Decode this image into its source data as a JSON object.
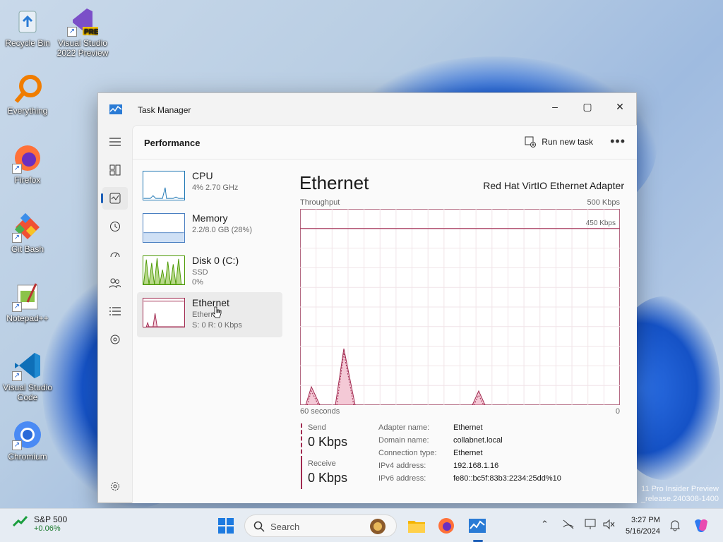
{
  "desktop": {
    "icons": [
      {
        "label": "Recycle Bin",
        "icon": "recycle-bin-icon"
      },
      {
        "label": "Visual Studio 2022 Preview",
        "icon": "visual-studio-icon",
        "badge": "PRE"
      },
      {
        "label": "Everything",
        "icon": "everything-search-icon"
      },
      {
        "label": "Firefox",
        "icon": "firefox-icon"
      },
      {
        "label": "Git Bash",
        "icon": "git-bash-icon"
      },
      {
        "label": "Notepad++",
        "icon": "notepadpp-icon"
      },
      {
        "label": "Visual Studio Code",
        "icon": "vscode-icon"
      },
      {
        "label": "Chromium",
        "icon": "chromium-icon"
      }
    ],
    "watermark_line1": "11 Pro Insider Preview",
    "watermark_line2": "_release.240308-1400"
  },
  "window": {
    "title": "Task Manager",
    "page_title": "Performance",
    "run_new_task": "Run new task",
    "more": "•••",
    "min": "–",
    "max": "▢",
    "close": "✕"
  },
  "perf_items": [
    {
      "name": "CPU",
      "sub1": "4%  2.70 GHz",
      "sub2": ""
    },
    {
      "name": "Memory",
      "sub1": "2.2/8.0 GB (28%)",
      "sub2": ""
    },
    {
      "name": "Disk 0 (C:)",
      "sub1": "SSD",
      "sub2": "0%"
    },
    {
      "name": "Ethernet",
      "sub1": "Ethern",
      "sub2": "S: 0  R: 0 Kbps"
    }
  ],
  "detail": {
    "title": "Ethernet",
    "adapter": "Red Hat VirtIO Ethernet Adapter",
    "throughput_label": "Throughput",
    "max_label": "500 Kbps",
    "line_label": "450 Kbps",
    "time_left": "60 seconds",
    "time_right": "0",
    "send_label": "Send",
    "send_value": "0 Kbps",
    "recv_label": "Receive",
    "recv_value": "0 Kbps",
    "props": [
      {
        "k": "Adapter name:",
        "v": "Ethernet"
      },
      {
        "k": "Domain name:",
        "v": "collabnet.local"
      },
      {
        "k": "Connection type:",
        "v": "Ethernet"
      },
      {
        "k": "IPv4 address:",
        "v": "192.168.1.16"
      },
      {
        "k": "IPv6 address:",
        "v": "fe80::bc5f:83b3:2234:25dd%10"
      }
    ]
  },
  "taskbar": {
    "ticker_name": "S&P 500",
    "ticker_change": "+0.06%",
    "search_placeholder": "Search",
    "time": "3:27 PM",
    "date": "5/16/2024"
  },
  "colors": {
    "accent": "#1d5fb8",
    "net_line": "#a0294f",
    "net_fill": "#f4c9d6",
    "cpu_line": "#1f77b4",
    "disk_line": "#4e9a06"
  }
}
